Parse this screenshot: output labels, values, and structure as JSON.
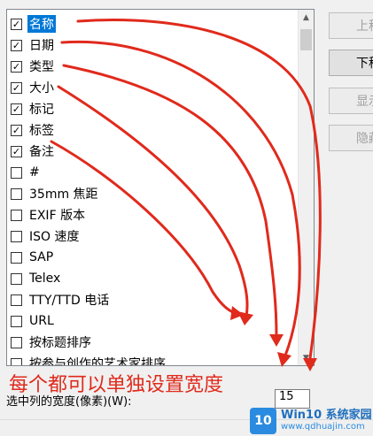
{
  "list": {
    "items": [
      {
        "label": "名称",
        "checked": true,
        "selected": true
      },
      {
        "label": "日期",
        "checked": true,
        "selected": false
      },
      {
        "label": "类型",
        "checked": true,
        "selected": false
      },
      {
        "label": "大小",
        "checked": true,
        "selected": false
      },
      {
        "label": "标记",
        "checked": true,
        "selected": false
      },
      {
        "label": "标签",
        "checked": true,
        "selected": false
      },
      {
        "label": "备注",
        "checked": true,
        "selected": false
      },
      {
        "label": "#",
        "checked": false,
        "selected": false
      },
      {
        "label": "35mm 焦距",
        "checked": false,
        "selected": false
      },
      {
        "label": "EXIF 版本",
        "checked": false,
        "selected": false
      },
      {
        "label": "ISO 速度",
        "checked": false,
        "selected": false
      },
      {
        "label": "SAP",
        "checked": false,
        "selected": false
      },
      {
        "label": "Telex",
        "checked": false,
        "selected": false
      },
      {
        "label": "TTY/TTD 电话",
        "checked": false,
        "selected": false
      },
      {
        "label": "URL",
        "checked": false,
        "selected": false
      },
      {
        "label": "按标题排序",
        "checked": false,
        "selected": false
      },
      {
        "label": "按参与创作的艺术家排序",
        "checked": false,
        "selected": false
      }
    ]
  },
  "buttons": {
    "move_up": "上移",
    "move_down": "下移",
    "show": "显示",
    "hide": "隐藏"
  },
  "annotation": "每个都可以单独设置宽度",
  "width_setting": {
    "label": "选中列的宽度(像素)(W):",
    "value": "15"
  },
  "watermark": {
    "logo": "10",
    "title": "Win10 系统家园",
    "url": "www.qdhuajin.com"
  },
  "colors": {
    "selection": "#0078d7",
    "annotation": "#e02a1c"
  }
}
